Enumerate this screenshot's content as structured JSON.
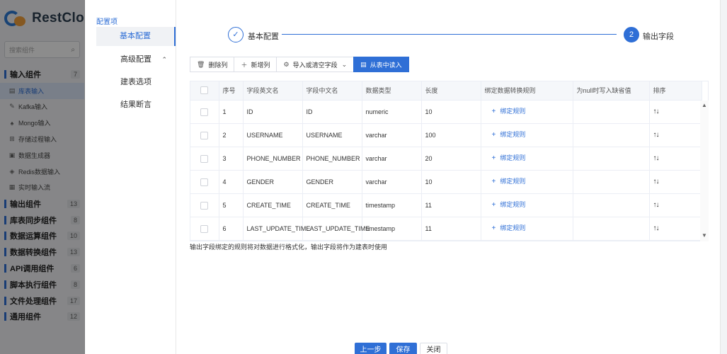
{
  "sidebar": {
    "logo_text": "RestClo",
    "search_placeholder": "搜索组件",
    "groups": [
      {
        "label": "输入组件",
        "count": "7"
      },
      {
        "label": "输出组件",
        "count": "13"
      },
      {
        "label": "库表同步组件",
        "count": "8"
      },
      {
        "label": "数据运算组件",
        "count": "10"
      },
      {
        "label": "数据转换组件",
        "count": "13"
      },
      {
        "label": "API调用组件",
        "count": "6"
      },
      {
        "label": "脚本执行组件",
        "count": "8"
      },
      {
        "label": "文件处理组件",
        "count": "17"
      },
      {
        "label": "通用组件",
        "count": "12"
      }
    ],
    "input_items": [
      {
        "label": "库表输入",
        "icon": "table-icon"
      },
      {
        "label": "Kafka输入",
        "icon": "kafka-icon"
      },
      {
        "label": "Mongo输入",
        "icon": "mongo-icon"
      },
      {
        "label": "存储过程输入",
        "icon": "procedure-icon"
      },
      {
        "label": "数据生成器",
        "icon": "generator-icon"
      },
      {
        "label": "Redis数据输入",
        "icon": "redis-icon"
      },
      {
        "label": "实时输入流",
        "icon": "stream-icon"
      }
    ]
  },
  "config_nav": {
    "title": "配置项",
    "items": [
      "基本配置",
      "高级配置",
      "建表选项",
      "结果断言"
    ]
  },
  "steps": [
    {
      "marker": "✓",
      "label": "基本配置"
    },
    {
      "marker": "2",
      "label": "输出字段"
    }
  ],
  "toolbar": {
    "delete_col": "删除列",
    "add_col": "新增列",
    "import_clear": "导入或清空字段",
    "read_from_table": "从表中读入"
  },
  "table": {
    "headers": [
      "序号",
      "字段英文名",
      "字段中文名",
      "数据类型",
      "长度",
      "绑定数据转换规则",
      "为null时写入缺省值",
      "排序"
    ],
    "bind_rule_label": "绑定规则",
    "sort_label": "↑↓",
    "rows": [
      {
        "no": "1",
        "en": "ID",
        "cn": "ID",
        "type": "numeric",
        "len": "10"
      },
      {
        "no": "2",
        "en": "USERNAME",
        "cn": "USERNAME",
        "type": "varchar",
        "len": "100"
      },
      {
        "no": "3",
        "en": "PHONE_NUMBER",
        "cn": "PHONE_NUMBER",
        "type": "varchar",
        "len": "20"
      },
      {
        "no": "4",
        "en": "GENDER",
        "cn": "GENDER",
        "type": "varchar",
        "len": "10"
      },
      {
        "no": "5",
        "en": "CREATE_TIME",
        "cn": "CREATE_TIME",
        "type": "timestamp",
        "len": "11"
      },
      {
        "no": "6",
        "en": "LAST_UPDATE_TIME",
        "cn": "LAST_UPDATE_TIME",
        "type": "timestamp",
        "len": "11"
      }
    ]
  },
  "hint": "输出字段绑定的规则将对数据进行格式化，输出字段将作为建表时使用",
  "footer": {
    "prev": "上一步",
    "save": "保存",
    "close": "关闭"
  }
}
